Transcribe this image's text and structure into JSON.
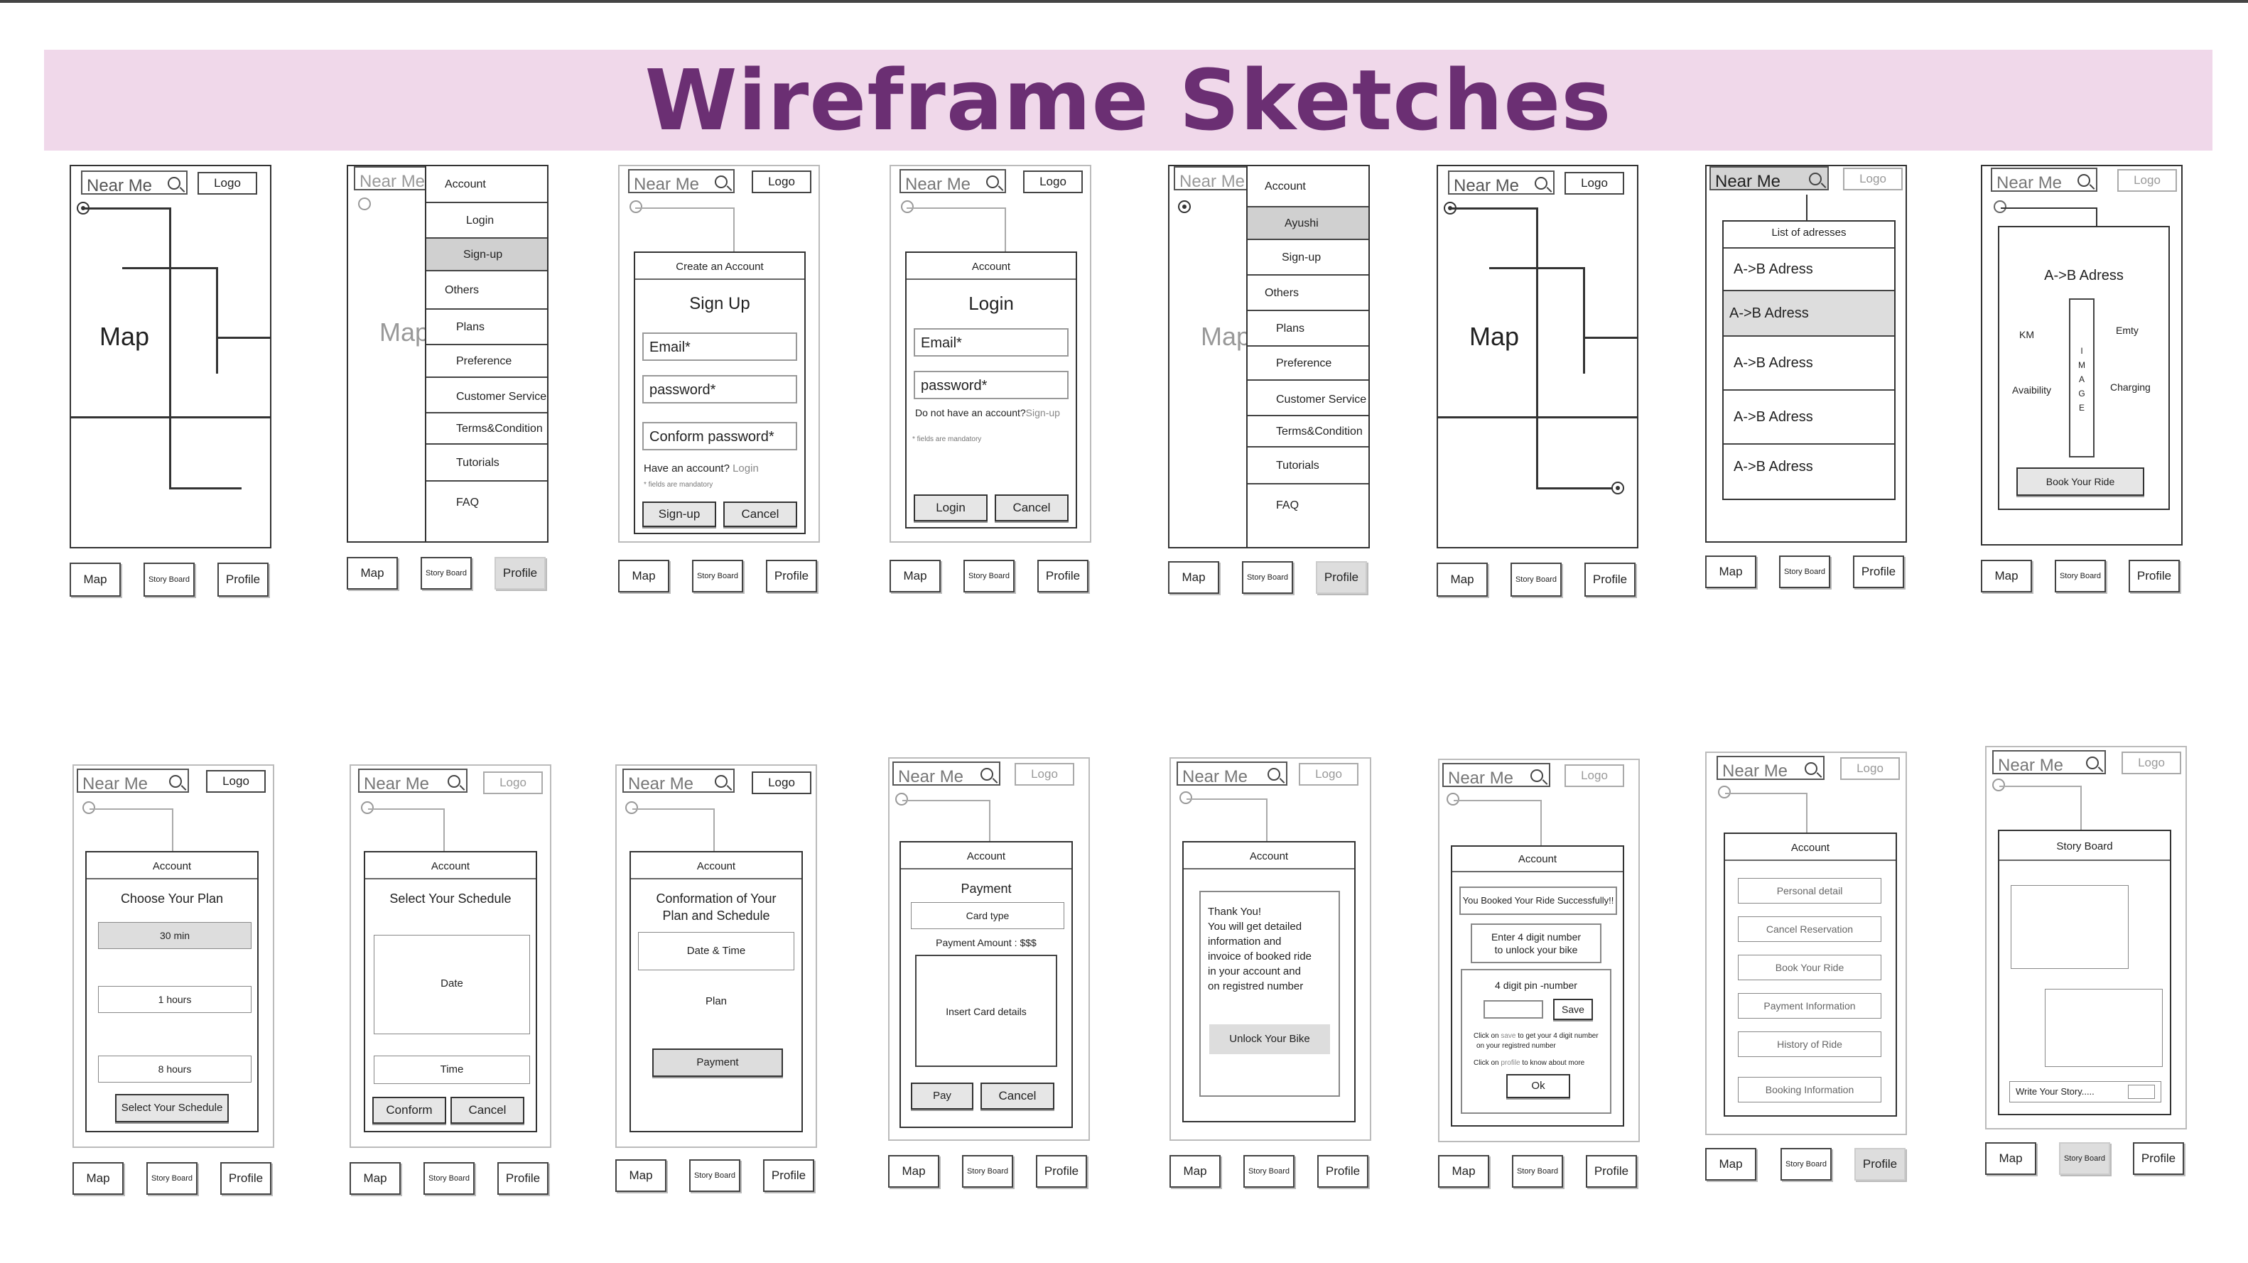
{
  "page": {
    "title": "Wireframe Sketches",
    "colors": {
      "banner_bg": "#f0d8ea",
      "title": "#6b2f73",
      "highlight": "#d0d0d0"
    }
  },
  "common": {
    "search_placeholder": "Near Me",
    "search_icon": "search-icon",
    "logo": "Logo",
    "nav": {
      "map": "Map",
      "story_board": "Story Board",
      "profile": "Profile"
    }
  },
  "map_screen": {
    "map_label": "Map"
  },
  "menu": {
    "header": "Account",
    "items": [
      "Login",
      "Sign-up",
      "Others",
      "Plans",
      "Preference",
      "Customer Service",
      "Terms&Condition",
      "Tutorials",
      "FAQ"
    ],
    "user_name": "Ayushi",
    "items_logged_in": [
      "Sign-up",
      "Others",
      "Plans",
      "Preference",
      "Customer Service",
      "Terms&Condition",
      "Tutorials",
      "FAQ"
    ],
    "bg_map_label": "Map"
  },
  "signup": {
    "header": "Create an Account",
    "title": "Sign Up",
    "email": "Email*",
    "password": "password*",
    "confirm": "Conform password*",
    "have_account": "Have an account? ",
    "login_link": "Login",
    "note": "* fields are mandatory",
    "signup_btn": "Sign-up",
    "cancel_btn": "Cancel"
  },
  "login": {
    "header": "Account",
    "title": "Login",
    "email": "Email*",
    "password": "password*",
    "no_account": "Do not have an account?",
    "signup_link": "Sign-up",
    "note": "* fields are mandatory",
    "login_btn": "Login",
    "cancel_btn": "Cancel"
  },
  "addresses": {
    "title": "List of adresses",
    "items": [
      "A->B Adress",
      "A->B Adress",
      "A->B Adress",
      "A->B Adress",
      "A->B Adress"
    ],
    "selected_index": 1
  },
  "bike_detail": {
    "route": "A->B Adress",
    "km": "KM",
    "emty": "Emty",
    "availability": "Avaibility",
    "charging": "Charging",
    "image_letters": [
      "I",
      "M",
      "A",
      "G",
      "E"
    ],
    "book_btn": "Book Your Ride"
  },
  "plan": {
    "header": "Account",
    "title": "Choose Your Plan",
    "options": [
      "30 min",
      "1 hours",
      "8 hours"
    ],
    "selected_index": 0,
    "btn": "Select  Your Schedule"
  },
  "schedule": {
    "header": "Account",
    "title": "Select Your Schedule",
    "date": "Date",
    "time": "Time",
    "confirm_btn": "Conform",
    "cancel_btn": "Cancel"
  },
  "confirmation": {
    "header": "Account",
    "title_line1": "Conformation of Your",
    "title_line2": "Plan and Schedule",
    "date_time": "Date & Time",
    "plan": "Plan",
    "payment_btn": "Payment"
  },
  "payment": {
    "header": "Account",
    "title": "Payment",
    "card_type": "Card type",
    "amount": "Payment Amount : $$$",
    "card_details": "Insert Card details",
    "pay_btn": "Pay",
    "cancel_btn": "Cancel"
  },
  "thanks": {
    "header": "Account",
    "lines": [
      "Thank You!",
      "You will get detailed",
      "information and",
      "invoice of booked ride",
      "in your account and",
      "on registred number"
    ],
    "unlock_btn": "Unlock Your Bike"
  },
  "unlock": {
    "header": "Account",
    "booked": "You Booked Your Ride Successfully!!",
    "enter_line1": "Enter 4 digit number",
    "enter_line2": "to unlock your bike",
    "pin_label": "4 digit pin -number",
    "save_btn": "Save",
    "note1a": "Click on ",
    "note1_link": "save",
    "note1b": " to get your 4 digit number",
    "note1c": "on your registred number",
    "note2a": "Click on ",
    "note2_link": "profile",
    "note2b": " to know about more",
    "ok_btn": "Ok"
  },
  "profile": {
    "header": "Account",
    "items": [
      "Personal detail",
      "Cancel Reservation",
      "Book Your Ride",
      "Payment Information",
      "History of Ride",
      "Booking Information"
    ]
  },
  "story": {
    "title": "Story Board",
    "write": "Write Your Story....."
  }
}
